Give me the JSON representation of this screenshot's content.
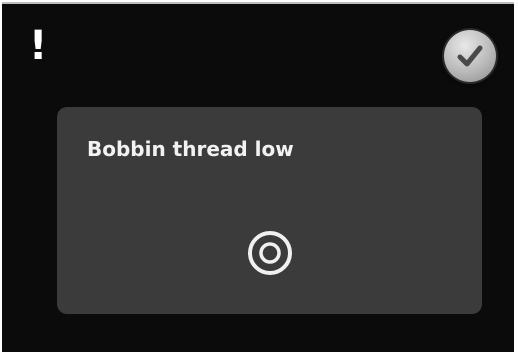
{
  "alert": {
    "symbol": "!"
  },
  "actions": {
    "confirm_icon": "checkmark-icon"
  },
  "message": {
    "title": "Bobbin thread low",
    "icon": "bobbin-icon"
  },
  "colors": {
    "screen_background": "#0b0b0b",
    "panel_background": "#3b3b3b",
    "text": "#f2f2f2",
    "checkmark": "#4a4a4a"
  }
}
